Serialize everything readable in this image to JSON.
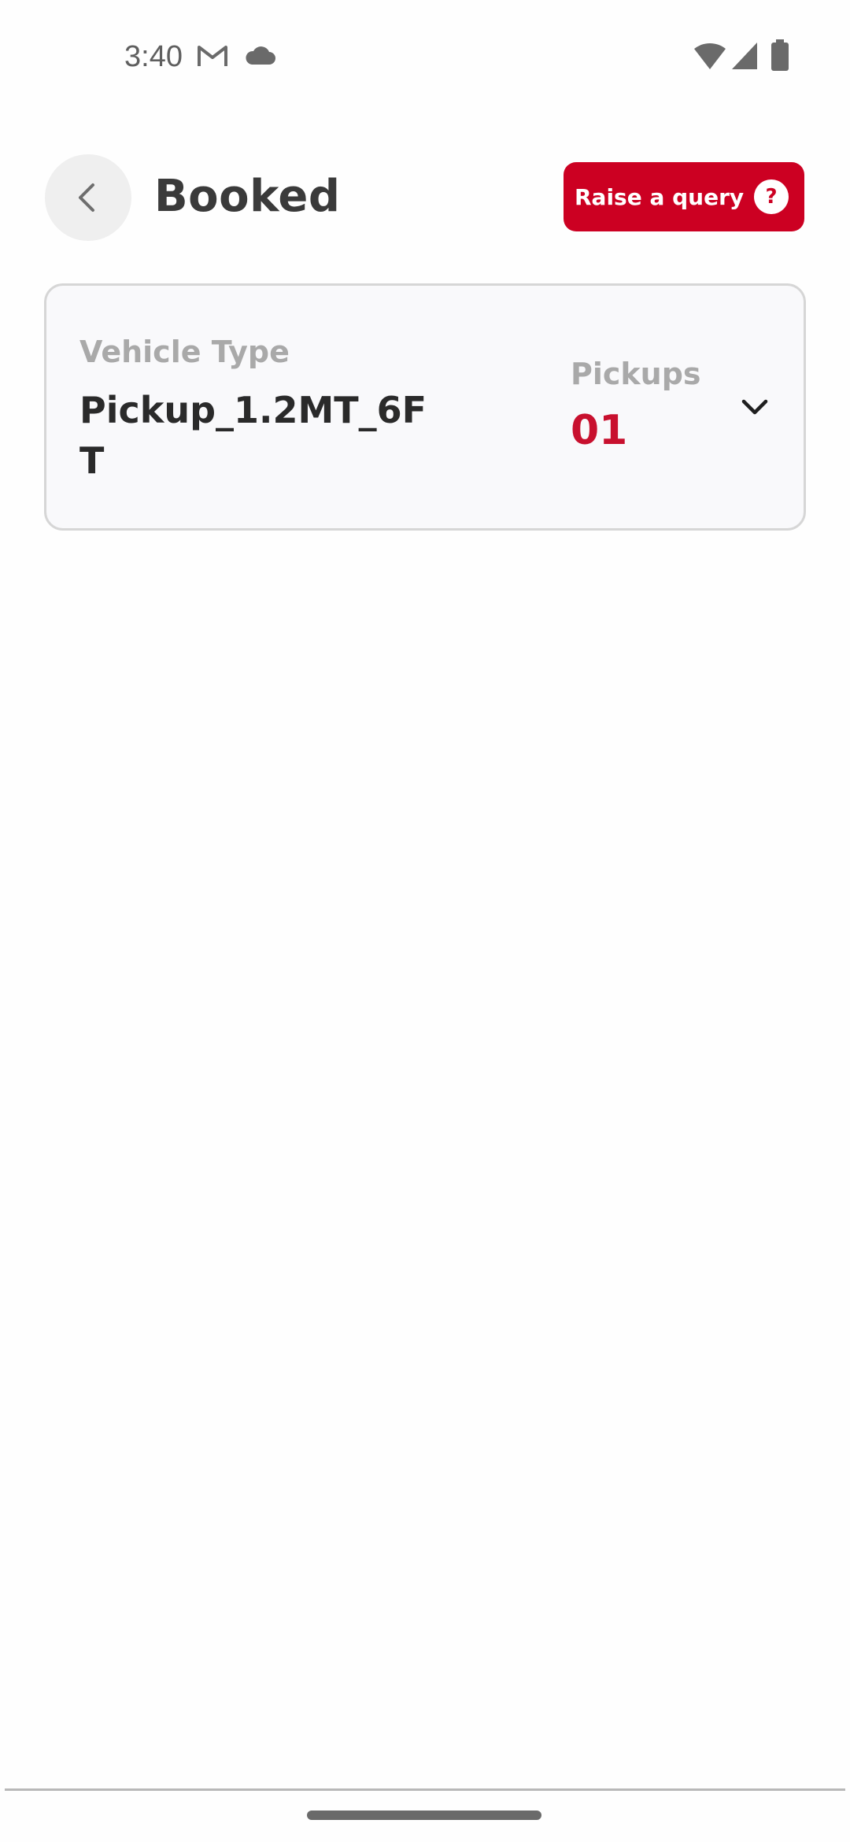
{
  "status_bar": {
    "time": "3:40",
    "icons": [
      "gmail-icon",
      "cloud-icon",
      "wifi-icon",
      "signal-icon",
      "battery-icon"
    ]
  },
  "header": {
    "title": "Booked",
    "back_icon": "chevron-left-icon",
    "query_button_label": "Raise a query",
    "query_icon_glyph": "?"
  },
  "vehicle_card": {
    "vehicle_type_label": "Vehicle Type",
    "vehicle_type_value": "Pickup_1.2MT_6FT",
    "pickups_label": "Pickups",
    "pickups_value": "01",
    "expand_icon": "chevron-down-icon"
  },
  "colors": {
    "accent": "#cc0022",
    "pickups_value": "#c8102e",
    "title_text": "#3a3a3a",
    "muted_label": "#a9a9a9",
    "card_background": "#f9f9fb",
    "card_border": "#d6d6d6",
    "back_button_bg": "#efefef"
  }
}
